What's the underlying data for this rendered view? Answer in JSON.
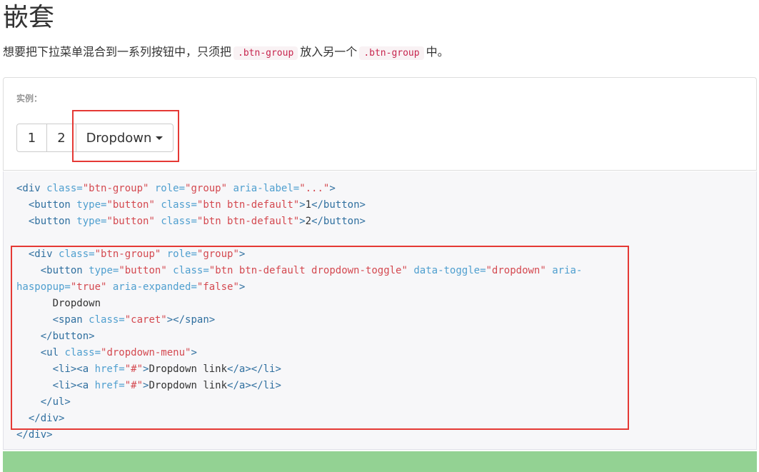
{
  "title": "嵌套",
  "description": {
    "part1": "想要把下拉菜单混合到一系列按钮中，只须把",
    "code1": ".btn-group",
    "part2": "放入另一个",
    "code2": ".btn-group",
    "part3": "中。"
  },
  "example": {
    "label": "实例：",
    "buttons": {
      "b1": "1",
      "b2": "2",
      "dropdown": "Dropdown"
    }
  },
  "code": {
    "l1": {
      "t1": "<div ",
      "a1": "class=",
      "v1": "\"btn-group\"",
      "a2": " role=",
      "v2": "\"group\"",
      "a3": " aria-label=",
      "v3": "\"...\"",
      "t2": ">"
    },
    "l2": {
      "t1": "  <button ",
      "a1": "type=",
      "v1": "\"button\"",
      "a2": " class=",
      "v2": "\"btn btn-default\"",
      "t2": ">",
      "txt": "1",
      "t3": "</button>"
    },
    "l3": {
      "t1": "  <button ",
      "a1": "type=",
      "v1": "\"button\"",
      "a2": " class=",
      "v2": "\"btn btn-default\"",
      "t2": ">",
      "txt": "2",
      "t3": "</button>"
    },
    "l5": {
      "t1": "  <div ",
      "a1": "class=",
      "v1": "\"btn-group\"",
      "a2": " role=",
      "v2": "\"group\"",
      "t2": ">"
    },
    "l6": {
      "t1": "    <button ",
      "a1": "type=",
      "v1": "\"button\"",
      "a2": " class=",
      "v2": "\"btn btn-default dropdown-toggle\"",
      "a3": " data-toggle=",
      "v3": "\"dropdown\"",
      "a4": " aria-"
    },
    "l7": {
      "a1": "haspopup=",
      "v1": "\"true\"",
      "a2": " aria-expanded=",
      "v2": "\"false\"",
      "t1": ">"
    },
    "l8": {
      "txt": "      Dropdown"
    },
    "l9": {
      "t1": "      <span ",
      "a1": "class=",
      "v1": "\"caret\"",
      "t2": "></span>"
    },
    "l10": {
      "t1": "    </button>"
    },
    "l11": {
      "t1": "    <ul ",
      "a1": "class=",
      "v1": "\"dropdown-menu\"",
      "t2": ">"
    },
    "l12": {
      "t1": "      <li><a ",
      "a1": "href=",
      "v1": "\"#\"",
      "t2": ">",
      "txt": "Dropdown link",
      "t3": "</a></li>"
    },
    "l13": {
      "t1": "      <li><a ",
      "a1": "href=",
      "v1": "\"#\"",
      "t2": ">",
      "txt": "Dropdown link",
      "t3": "</a></li>"
    },
    "l14": {
      "t1": "    </ul>"
    },
    "l15": {
      "t1": "  </div>"
    },
    "l16": {
      "t1": "</div>"
    }
  },
  "colors": {
    "highlight": "#e53935",
    "code_value": "#d44950",
    "code_attr": "#4f9fcf",
    "code_tag": "#2f6f9f",
    "footer_bar": "#93d293"
  }
}
